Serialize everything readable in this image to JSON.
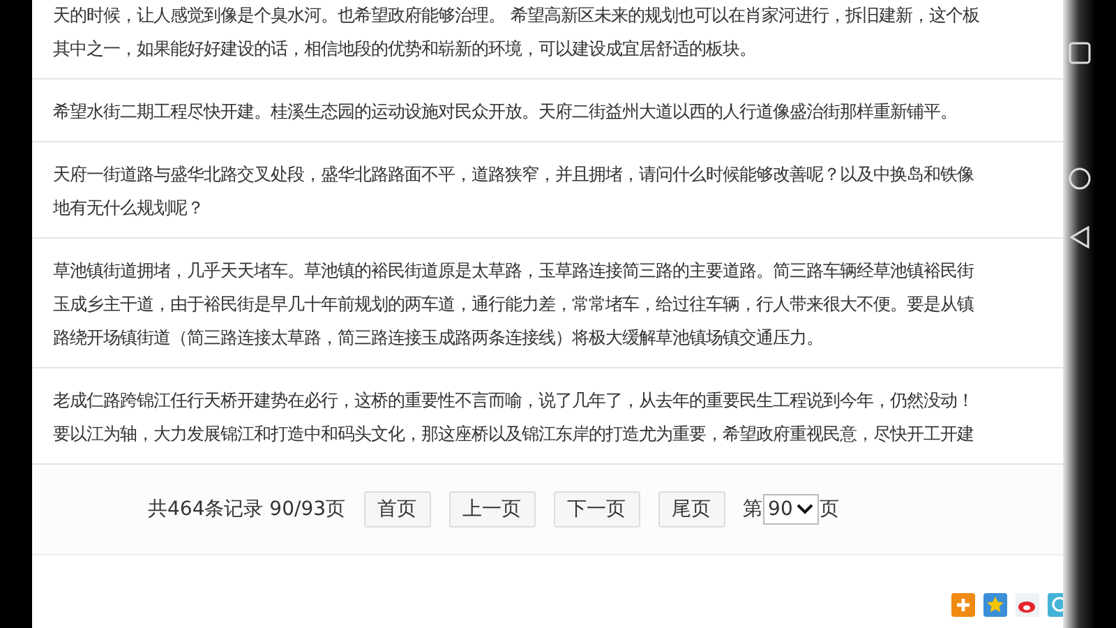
{
  "posts": [
    {
      "lines": [
        "天的时候，让人感觉到像是个臭水河。也希望政府能够治理。 希望高新区未来的规划也可以在肖家河进行，拆旧建新，这个板",
        "其中之一，如果能好好建设的话，相信地段的优势和崭新的环境，可以建设成宜居舒适的板块。"
      ]
    },
    {
      "lines": [
        "希望水街二期工程尽快开建。桂溪生态园的运动设施对民众开放。天府二街益州大道以西的人行道像盛治街那样重新铺平。"
      ]
    },
    {
      "lines": [
        "天府一街道路与盛华北路交叉处段，盛华北路路面不平，道路狭窄，并且拥堵，请问什么时候能够改善呢？以及中换岛和铁像",
        "地有无什么规划呢？"
      ]
    },
    {
      "lines": [
        "草池镇街道拥堵，几乎天天堵车。草池镇的裕民街道原是太草路，玉草路连接简三路的主要道路。简三路车辆经草池镇裕民街",
        "玉成乡主干道，由于裕民街是早几十年前规划的两车道，通行能力差，常常堵车，给过往车辆，行人带来很大不便。要是从镇",
        "路绕开场镇街道（简三路连接太草路，简三路连接玉成路两条连接线）将极大缓解草池镇场镇交通压力。"
      ]
    },
    {
      "lines": [
        "老成仁路跨锦江任行天桥开建势在必行，这桥的重要性不言而喻，说了几年了，从去年的重要民生工程说到今年，仍然没动！",
        "要以江为轴，大力发展锦江和打造中和码头文化，那这座桥以及锦江东岸的打造尤为重要，希望政府重视民意，尽快开工开建"
      ]
    }
  ],
  "pagination": {
    "summary": "共464条记录 90/93页",
    "buttons": [
      "首页",
      "上一页",
      "下一页",
      "尾页"
    ],
    "page_prefix": "第",
    "page_value": "90",
    "page_suffix": "页"
  }
}
